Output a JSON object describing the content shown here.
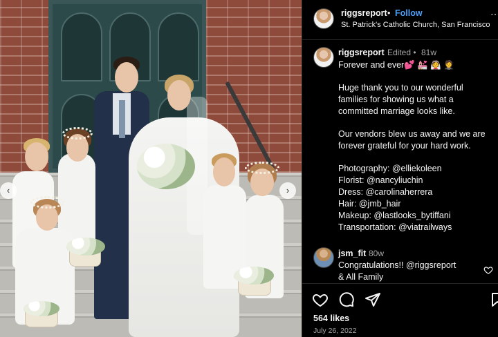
{
  "post": {
    "username": "riggsreport",
    "dot": "•",
    "follow_label": "Follow",
    "location": "St. Patrick's Catholic Church, San Francisco",
    "more_icon": "more-icon"
  },
  "caption": {
    "username": "riggsreport",
    "edited_label": "Edited •",
    "time": "81w",
    "lines": [
      "Forever and ever💕 💒 👰 🤵",
      "Huge thank you to our wonderful",
      "families for showing us what a",
      "committed marriage looks like.",
      "Our vendors blew us away and we are",
      "forever grateful for your hard work.",
      "Photography: @elliekoleen",
      "Florist: @nancyliuchin",
      "Dress: @carolinaherrera",
      "Hair: @jmb_hair",
      "Makeup: @lastlooks_bytiffani",
      "Transportation: @viatrailways"
    ]
  },
  "comment": {
    "username": "jsm_fit",
    "time": "80w",
    "lines": [
      "Congratulations!! @riggsreport",
      "& All Family"
    ]
  },
  "actions": {
    "icons": [
      "heart-icon",
      "comment-icon",
      "share-icon",
      "save-icon"
    ]
  },
  "likes": "564 likes",
  "date": "July 26, 2022",
  "carousel": {
    "prev": "‹",
    "next": "›"
  },
  "colors": {
    "background": "#000000",
    "link": "#4ca0f5",
    "muted": "#a8a8a8",
    "text": "#f5f5f5"
  }
}
